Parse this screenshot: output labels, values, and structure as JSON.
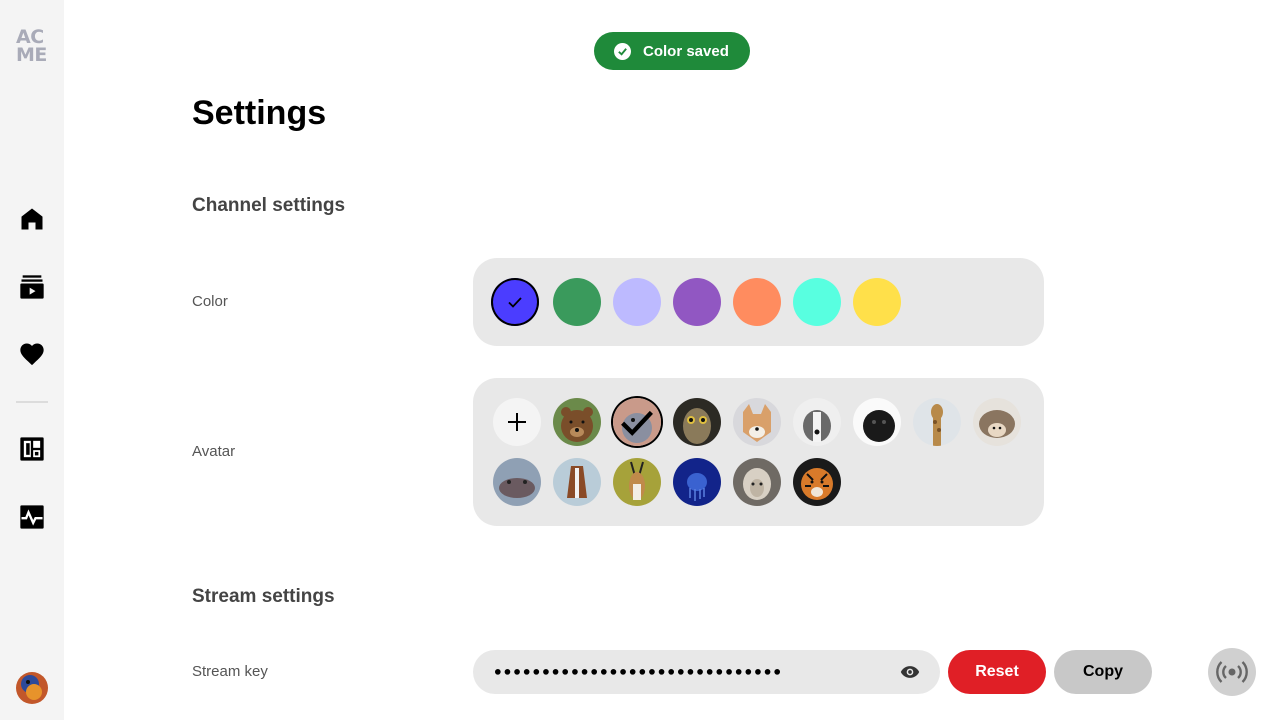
{
  "app": {
    "logo_line1": "AC",
    "logo_line2": "ME"
  },
  "sidebar": {
    "items": [
      {
        "name": "home",
        "icon": "home-icon"
      },
      {
        "name": "videos",
        "icon": "video-library-icon"
      },
      {
        "name": "favorites",
        "icon": "heart-icon"
      },
      {
        "name": "dashboard",
        "icon": "dashboard-icon"
      },
      {
        "name": "activity",
        "icon": "pulse-icon"
      }
    ],
    "user_avatar_icon": "user-avatar-parrot"
  },
  "toast": {
    "text": "Color saved",
    "icon": "check-circle-icon",
    "color": "#1f8a3a"
  },
  "page": {
    "title": "Settings"
  },
  "channel_settings": {
    "title": "Channel settings",
    "color_label": "Color",
    "colors": [
      "#4b3dff",
      "#3a9a5c",
      "#bdbaff",
      "#9157c2",
      "#ff8c5f",
      "#58ffe0",
      "#ffe04a"
    ],
    "selected_color_index": 0,
    "avatar_label": "Avatar",
    "avatars": [
      "bear",
      "parrot",
      "owl",
      "dog-shiba",
      "dog-pitbull",
      "pug",
      "giraffe",
      "hedgehog",
      "hippo",
      "horse",
      "antelope",
      "jellyfish",
      "sheep",
      "tiger"
    ],
    "selected_avatar_index": 1
  },
  "stream_settings": {
    "title": "Stream settings",
    "stream_key_label": "Stream key",
    "stream_key_value": "••••••••••••••••••••••••••••••",
    "reset_label": "Reset",
    "copy_label": "Copy"
  },
  "colors": {
    "danger": "#e01f26",
    "success": "#1f8a3a",
    "panel": "#e8e8e8",
    "sidebar": "#f4f4f4"
  }
}
